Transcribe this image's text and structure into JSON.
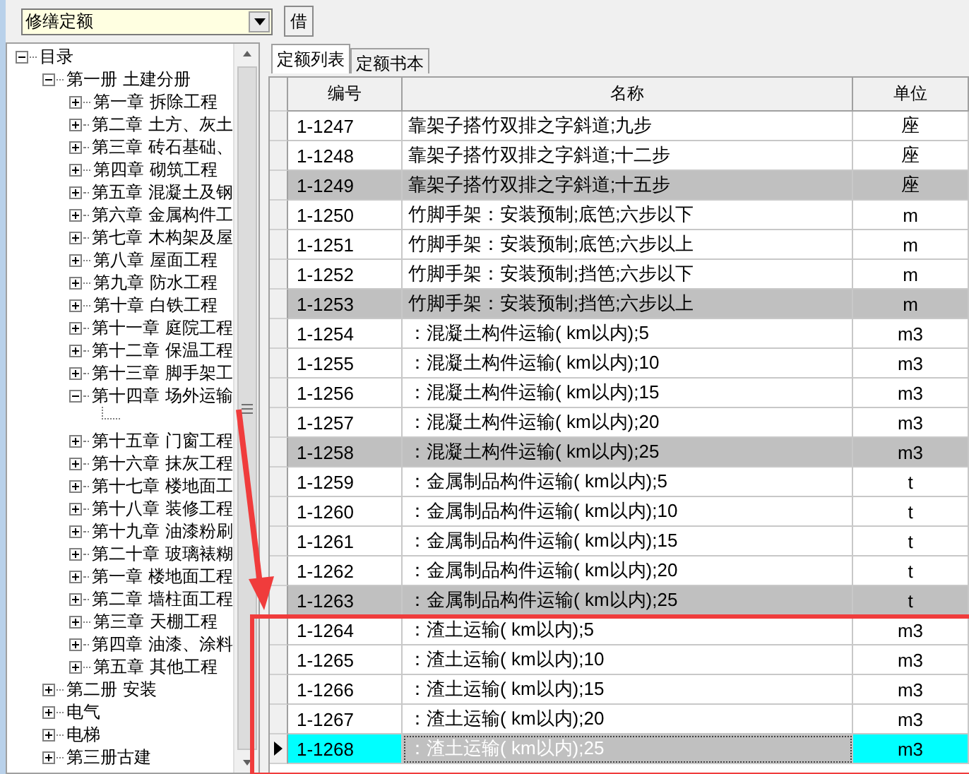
{
  "toolbar": {
    "combo_value": "修缮定额",
    "button": "借"
  },
  "tree": [
    {
      "label": "目录",
      "expanded": true,
      "children": [
        {
          "label": "第一册 土建分册",
          "expanded": true,
          "children": [
            {
              "label": "第一章 拆除工程",
              "expanded": false
            },
            {
              "label": "第二章 土方、灰土",
              "expanded": false
            },
            {
              "label": "第三章 砖石基础、",
              "expanded": false
            },
            {
              "label": "第四章 砌筑工程",
              "expanded": false
            },
            {
              "label": "第五章 混凝土及钢",
              "expanded": false
            },
            {
              "label": "第六章 金属构件工",
              "expanded": false
            },
            {
              "label": "第七章 木构架及屋",
              "expanded": false
            },
            {
              "label": "第八章 屋面工程",
              "expanded": false
            },
            {
              "label": "第九章 防水工程",
              "expanded": false
            },
            {
              "label": "第十章 白铁工程",
              "expanded": false
            },
            {
              "label": "第十一章 庭院工程",
              "expanded": false
            },
            {
              "label": "第十二章 保温工程",
              "expanded": false
            },
            {
              "label": "第十三章 脚手架工",
              "expanded": false
            },
            {
              "label": "第十四章 场外运输",
              "expanded": true
            },
            {
              "label": "第十五章 门窗工程",
              "expanded": false
            },
            {
              "label": "第十六章 抹灰工程",
              "expanded": false
            },
            {
              "label": "第十七章 楼地面工",
              "expanded": false
            },
            {
              "label": "第十八章 装修工程",
              "expanded": false
            },
            {
              "label": "第十九章 油漆粉刷",
              "expanded": false
            },
            {
              "label": "第二十章 玻璃裱糊",
              "expanded": false
            },
            {
              "label": "第一章 楼地面工程",
              "expanded": false
            },
            {
              "label": "第二章 墙柱面工程",
              "expanded": false
            },
            {
              "label": "第三章 天棚工程",
              "expanded": false
            },
            {
              "label": "第四章 油漆、涂料",
              "expanded": false
            },
            {
              "label": "第五章 其他工程",
              "expanded": false
            }
          ]
        },
        {
          "label": "第二册 安装",
          "expanded": false
        },
        {
          "label": "电气",
          "expanded": false
        },
        {
          "label": "电梯",
          "expanded": false
        },
        {
          "label": "第三册古建",
          "expanded": false
        }
      ]
    }
  ],
  "tabs": [
    {
      "label": "定额列表",
      "selected": true
    },
    {
      "label": "定额书本",
      "selected": false
    }
  ],
  "grid": {
    "columns": [
      "编号",
      "名称",
      "单位"
    ],
    "rows": [
      {
        "code": "1-1247",
        "name": "靠架子搭竹双排之字斜道;九步",
        "unit": "座",
        "shaded": false,
        "selected": false
      },
      {
        "code": "1-1248",
        "name": "靠架子搭竹双排之字斜道;十二步",
        "unit": "座",
        "shaded": false,
        "selected": false
      },
      {
        "code": "1-1249",
        "name": "靠架子搭竹双排之字斜道;十五步",
        "unit": "座",
        "shaded": true,
        "selected": false
      },
      {
        "code": "1-1250",
        "name": "竹脚手架：安装预制;底笆;六步以下",
        "unit": "m",
        "shaded": false,
        "selected": false
      },
      {
        "code": "1-1251",
        "name": "竹脚手架：安装预制;底笆;六步以上",
        "unit": "m",
        "shaded": false,
        "selected": false
      },
      {
        "code": "1-1252",
        "name": "竹脚手架：安装预制;挡笆;六步以下",
        "unit": "m",
        "shaded": false,
        "selected": false
      },
      {
        "code": "1-1253",
        "name": "竹脚手架：安装预制;挡笆;六步以上",
        "unit": "m",
        "shaded": true,
        "selected": false
      },
      {
        "code": "1-1254",
        "name": "：混凝土构件运输( km以内);5",
        "unit": "m3",
        "shaded": false,
        "selected": false
      },
      {
        "code": "1-1255",
        "name": "：混凝土构件运输( km以内);10",
        "unit": "m3",
        "shaded": false,
        "selected": false
      },
      {
        "code": "1-1256",
        "name": "：混凝土构件运输( km以内);15",
        "unit": "m3",
        "shaded": false,
        "selected": false
      },
      {
        "code": "1-1257",
        "name": "：混凝土构件运输( km以内);20",
        "unit": "m3",
        "shaded": false,
        "selected": false
      },
      {
        "code": "1-1258",
        "name": "：混凝土构件运输( km以内);25",
        "unit": "m3",
        "shaded": true,
        "selected": false
      },
      {
        "code": "1-1259",
        "name": "：金属制品构件运输( km以内);5",
        "unit": "t",
        "shaded": false,
        "selected": false
      },
      {
        "code": "1-1260",
        "name": "：金属制品构件运输( km以内);10",
        "unit": "t",
        "shaded": false,
        "selected": false
      },
      {
        "code": "1-1261",
        "name": "：金属制品构件运输( km以内);15",
        "unit": "t",
        "shaded": false,
        "selected": false
      },
      {
        "code": "1-1262",
        "name": "：金属制品构件运输( km以内);20",
        "unit": "t",
        "shaded": false,
        "selected": false
      },
      {
        "code": "1-1263",
        "name": "：金属制品构件运输( km以内);25",
        "unit": "t",
        "shaded": true,
        "selected": false
      },
      {
        "code": "1-1264",
        "name": "：渣土运输( km以内);5",
        "unit": "m3",
        "shaded": false,
        "selected": false
      },
      {
        "code": "1-1265",
        "name": "：渣土运输( km以内);10",
        "unit": "m3",
        "shaded": false,
        "selected": false
      },
      {
        "code": "1-1266",
        "name": "：渣土运输( km以内);15",
        "unit": "m3",
        "shaded": false,
        "selected": false
      },
      {
        "code": "1-1267",
        "name": "：渣土运输( km以内);20",
        "unit": "m3",
        "shaded": false,
        "selected": false
      },
      {
        "code": "1-1268",
        "name": "：渣土运输( km以内);25",
        "unit": "m3",
        "shaded": false,
        "selected": true
      }
    ]
  }
}
